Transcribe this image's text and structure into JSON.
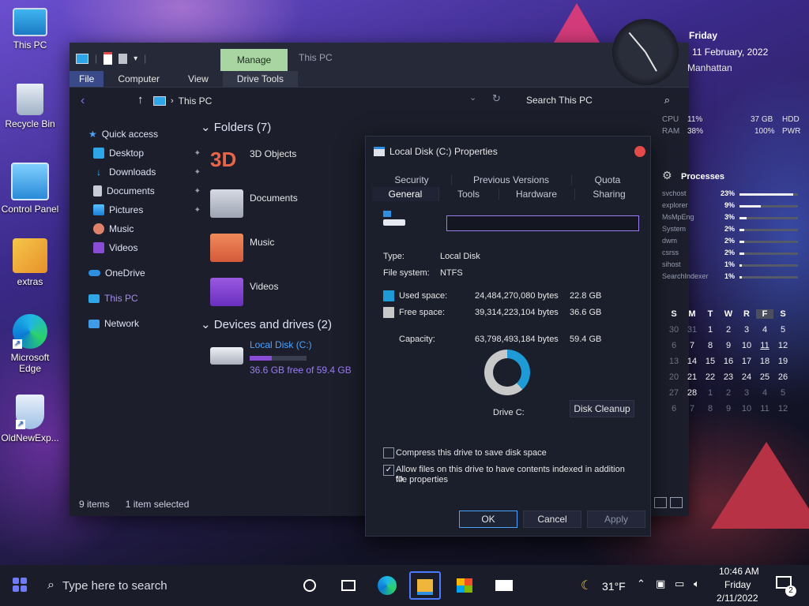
{
  "desktop": {
    "icons": [
      {
        "label": "This PC"
      },
      {
        "label": "Recycle Bin"
      },
      {
        "label": "Control Panel"
      },
      {
        "label": "extras"
      },
      {
        "label": "Microsoft Edge"
      },
      {
        "label": "OldNewExp..."
      }
    ]
  },
  "explorer": {
    "title": "This PC",
    "manage_tab": "Manage",
    "ribbon_tabs": [
      "File",
      "Computer",
      "View",
      "Drive Tools"
    ],
    "address": "This PC",
    "search_placeholder": "Search This PC",
    "nav": {
      "quick_access": "Quick access",
      "items": [
        "Desktop",
        "Downloads",
        "Documents",
        "Pictures",
        "Music",
        "Videos"
      ],
      "onedrive": "OneDrive",
      "this_pc": "This PC",
      "network": "Network"
    },
    "folders_header": "Folders (7)",
    "folders": [
      "3D Objects",
      "Documents",
      "Music",
      "Videos"
    ],
    "folder_3d_glyph": "3D",
    "devices_header": "Devices and drives (2)",
    "drive": {
      "name": "Local Disk (C:)",
      "free_text": "36.6 GB free of 59.4 GB",
      "used_fraction": 0.384
    },
    "status": {
      "items": "9 items",
      "selected": "1 item selected"
    }
  },
  "dialog": {
    "title": "Local Disk (C:) Properties",
    "tabs_row1": [
      "Security",
      "Previous Versions",
      "Quota"
    ],
    "tabs_row2": [
      "General",
      "Tools",
      "Hardware",
      "Sharing"
    ],
    "name_value": "",
    "type_label": "Type:",
    "type_value": "Local Disk",
    "fs_label": "File system:",
    "fs_value": "NTFS",
    "used_label": "Used space:",
    "used_bytes": "24,484,270,080 bytes",
    "used_gb": "22.8 GB",
    "free_label": "Free space:",
    "free_bytes": "39,314,223,104 bytes",
    "free_gb": "36.6 GB",
    "cap_label": "Capacity:",
    "cap_bytes": "63,798,493,184 bytes",
    "cap_gb": "59.4 GB",
    "drive_label": "Drive C:",
    "cleanup": "Disk Cleanup",
    "compress": "Compress this drive to save disk space",
    "index": "Allow files on this drive to have contents indexed in addition to",
    "index2": "file properties",
    "ok": "OK",
    "cancel": "Cancel",
    "apply": "Apply",
    "colors": {
      "used": "#1e9bd7",
      "free": "#c8c8c8"
    }
  },
  "widget": {
    "day": "Friday",
    "date": "11 February, 2022",
    "city": "Manhattan",
    "cpu_label": "CPU",
    "cpu": "11%",
    "ram_label": "RAM",
    "ram": "38%",
    "hdd_val": "37 GB",
    "hdd_label": "HDD",
    "pwr_val": "100%",
    "pwr_label": "PWR",
    "processes_title": "Processes",
    "processes": [
      {
        "name": "svchost",
        "pct": "23%",
        "level": 0.92
      },
      {
        "name": "explorer",
        "pct": "9%",
        "level": 0.36
      },
      {
        "name": "MsMpEng",
        "pct": "3%",
        "level": 0.12
      },
      {
        "name": "System",
        "pct": "2%",
        "level": 0.08
      },
      {
        "name": "dwm",
        "pct": "2%",
        "level": 0.08
      },
      {
        "name": "csrss",
        "pct": "2%",
        "level": 0.08
      },
      {
        "name": "sihost",
        "pct": "1%",
        "level": 0.04
      },
      {
        "name": "SearchIndexer",
        "pct": "1%",
        "level": 0.04
      }
    ],
    "cal_header": [
      "S",
      "M",
      "T",
      "W",
      "R",
      "F",
      "S"
    ],
    "cal_rows": [
      [
        "30",
        "31",
        "1",
        "2",
        "3",
        "4",
        "5"
      ],
      [
        "6",
        "7",
        "8",
        "9",
        "10",
        "11",
        "12"
      ],
      [
        "13",
        "14",
        "15",
        "16",
        "17",
        "18",
        "19"
      ],
      [
        "20",
        "21",
        "22",
        "23",
        "24",
        "25",
        "26"
      ],
      [
        "27",
        "28",
        "1",
        "2",
        "3",
        "4",
        "5"
      ],
      [
        "6",
        "7",
        "8",
        "9",
        "10",
        "11",
        "12"
      ]
    ]
  },
  "taskbar": {
    "search_placeholder": "Type here to search",
    "temp": "31°F",
    "time": "10:46 AM",
    "day": "Friday",
    "date": "2/11/2022",
    "notif_count": "2"
  }
}
